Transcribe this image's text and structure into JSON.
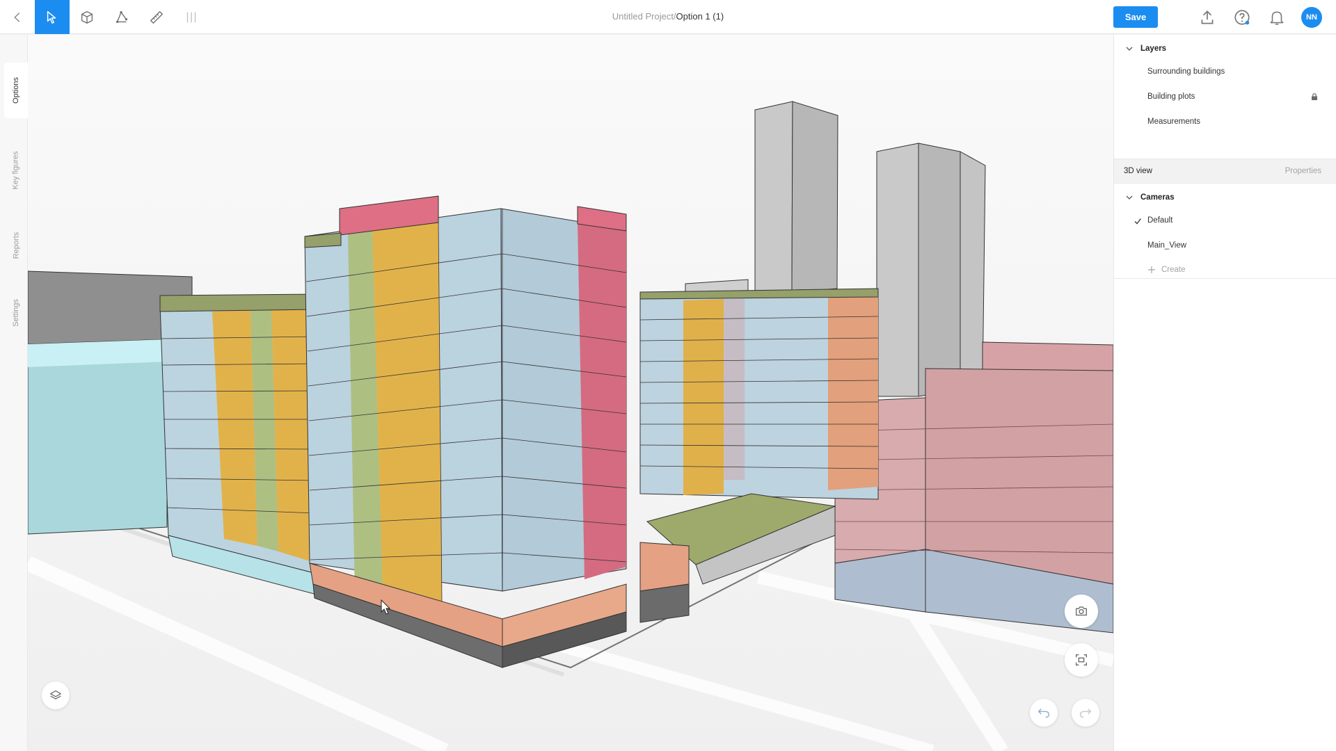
{
  "project": {
    "name_prefix": "Untitled Project/",
    "option_name": "Option 1 (1)"
  },
  "toolbar": {
    "back_icon": "chevron-left-icon",
    "tools": [
      "select-cursor-icon",
      "box-3d-icon",
      "polyline-icon",
      "ruler-icon",
      "grid-lines-icon"
    ],
    "active_tool": "select-cursor-icon",
    "save_label": "Save",
    "right_icons": [
      "upload-icon",
      "help-icon",
      "bell-icon"
    ],
    "avatar_initials": "NN",
    "accent_color": "#1c8df0"
  },
  "left_tabs": [
    {
      "label": "Options",
      "active": true
    },
    {
      "label": "Key figures",
      "active": false
    },
    {
      "label": "Reports",
      "active": false
    },
    {
      "label": "Settings",
      "active": false
    }
  ],
  "layers": {
    "header": "Layers",
    "items": [
      {
        "label": "Surrounding buildings",
        "locked": false
      },
      {
        "label": "Building plots",
        "locked": true
      },
      {
        "label": "Measurements",
        "locked": false
      }
    ]
  },
  "view_bar": {
    "left_label": "3D view",
    "right_label": "Properties"
  },
  "cameras": {
    "header": "Cameras",
    "items": [
      {
        "label": "Default",
        "checked": true
      },
      {
        "label": "Main_View",
        "checked": false
      }
    ],
    "create_label": "Create"
  },
  "viewport_controls": [
    "camera-icon",
    "frame-focus-icon",
    "undo-icon",
    "redo-icon",
    "layers-icon"
  ]
}
